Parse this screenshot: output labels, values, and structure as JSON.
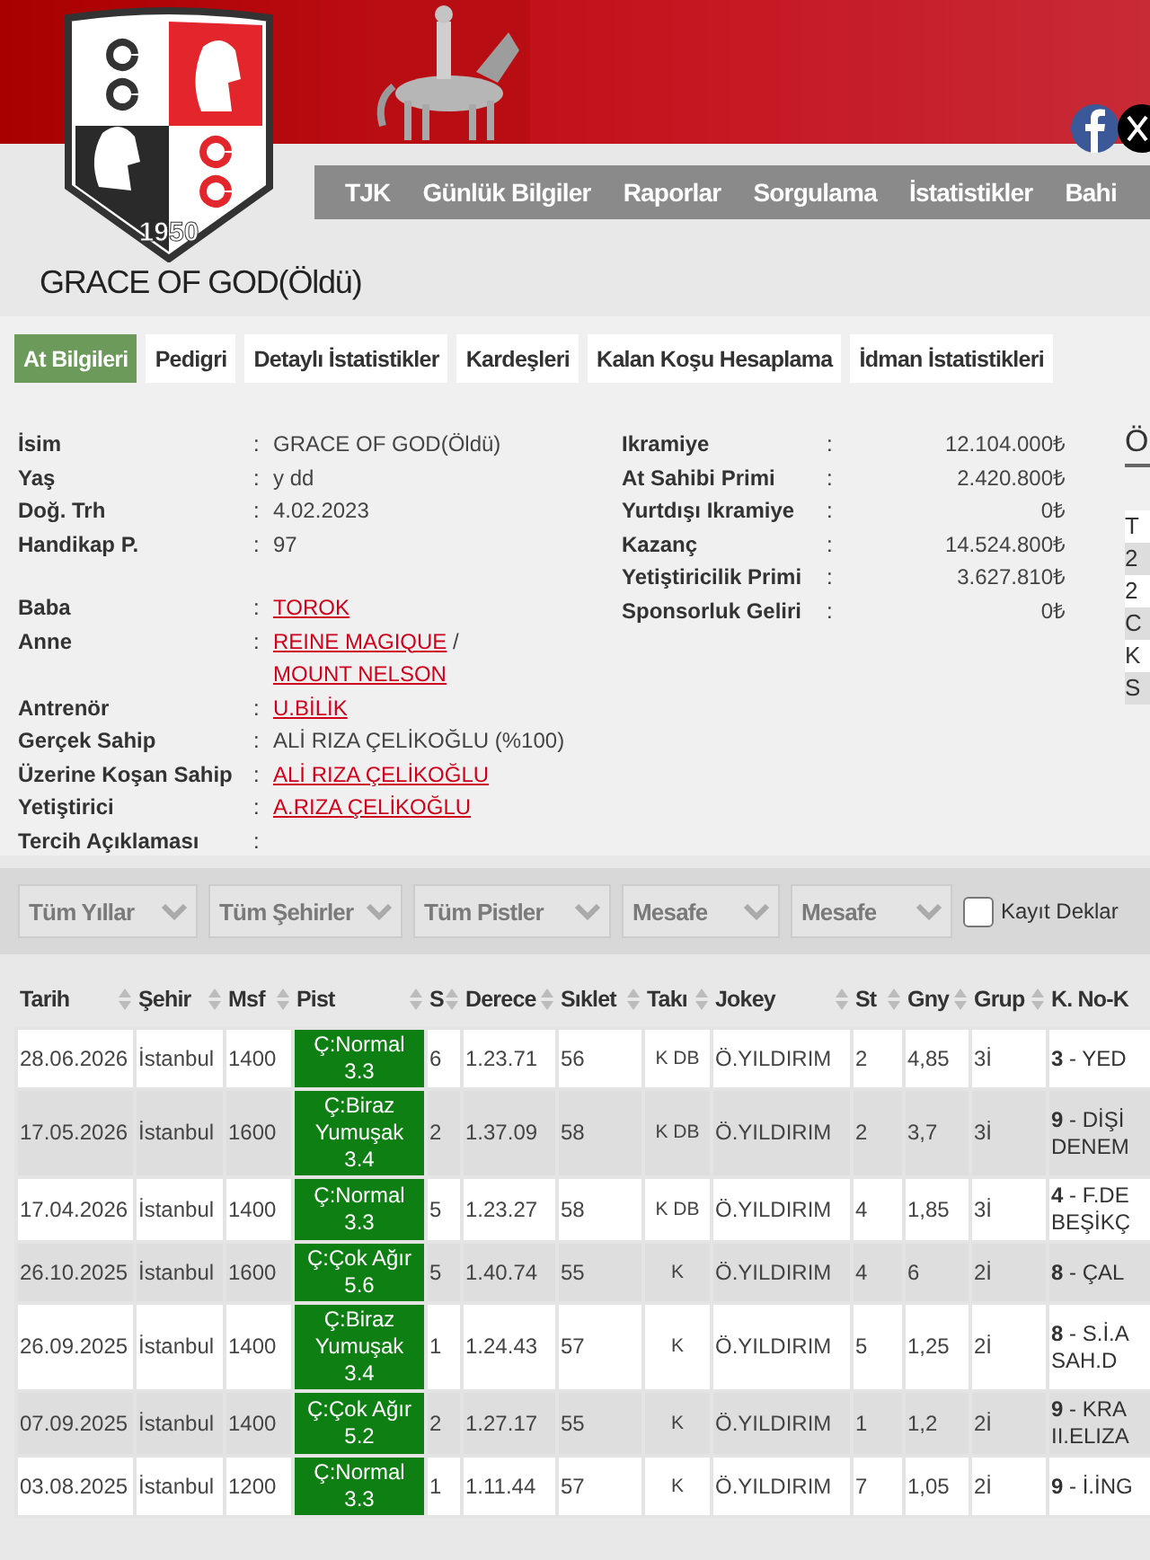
{
  "header": {
    "logo_year": "1950",
    "nav": [
      "TJK",
      "Günlük Bilgiler",
      "Raporlar",
      "Sorgulama",
      "İstatistikler",
      "Bahi"
    ]
  },
  "horse_name": "GRACE OF GOD(Öldü)",
  "tabs": [
    {
      "label": "At Bilgileri",
      "selected": true
    },
    {
      "label": "Pedigri",
      "selected": false
    },
    {
      "label": "Detaylı İstatistikler",
      "selected": false
    },
    {
      "label": "Kardeşleri",
      "selected": false
    },
    {
      "label": "Kalan Koşu Hesaplama",
      "selected": false
    },
    {
      "label": "İdman İstatistikleri",
      "selected": false
    }
  ],
  "info_left": [
    [
      {
        "label": "İsim",
        "parts": [
          {
            "text": "GRACE OF GOD(Öldü)",
            "link": false
          }
        ]
      },
      {
        "label": "Yaş",
        "parts": [
          {
            "text": "y dd",
            "link": false
          }
        ]
      },
      {
        "label": "Doğ. Trh",
        "parts": [
          {
            "text": "4.02.2023",
            "link": false
          }
        ]
      },
      {
        "label": "Handikap P.",
        "parts": [
          {
            "text": "97",
            "link": false
          }
        ]
      }
    ],
    [
      {
        "label": "Baba",
        "parts": [
          {
            "text": "TOROK",
            "link": true
          }
        ]
      },
      {
        "label": "Anne",
        "parts": [
          {
            "text": "REINE MAGIQUE",
            "link": true
          },
          {
            "text": "/",
            "link": false
          },
          {
            "text": "MOUNT NELSON",
            "link": true
          }
        ]
      },
      {
        "label": "Antrenör",
        "parts": [
          {
            "text": "U.BİLİK",
            "link": true
          }
        ]
      },
      {
        "label": "Gerçek Sahip",
        "parts": [
          {
            "text": "ALİ RIZA ÇELİKOĞLU (%100)",
            "link": false
          }
        ]
      },
      {
        "label": "Üzerine Koşan Sahip",
        "parts": [
          {
            "text": "ALİ RIZA ÇELİKOĞLU",
            "link": true
          }
        ]
      },
      {
        "label": "Yetiştirici",
        "parts": [
          {
            "text": "A.RIZA ÇELİKOĞLU",
            "link": true
          }
        ]
      },
      {
        "label": "Tercih Açıklaması"
      }
    ]
  ],
  "separator": ":",
  "info_right": [
    {
      "label": "Ikramiye",
      "value": "12.104.000₺"
    },
    {
      "label": "At Sahibi Primi",
      "value": "2.420.800₺"
    },
    {
      "label": "Yurtdışı Ikramiye",
      "value": "0₺"
    },
    {
      "label": "Kazanç",
      "value": "14.524.800₺"
    },
    {
      "label": "Yetiştiricilik Primi",
      "value": "3.627.810₺"
    },
    {
      "label": "Sponsorluk Geliri",
      "value": "0₺"
    }
  ],
  "side_panel": {
    "heading": "Ö",
    "rows": [
      "T",
      "2",
      "2",
      "C",
      "K",
      "S"
    ]
  },
  "filters": {
    "selects": [
      "Tüm Yıllar",
      "Tüm Şehirler",
      "Tüm Pistler",
      "Mesafe",
      "Mesafe"
    ],
    "checkbox": {
      "label": "Kayıt Deklar",
      "checked": false
    }
  },
  "table": {
    "columns": [
      "Tarih",
      "Şehir",
      "Msf",
      "Pist",
      "S",
      "Derece",
      "Sıklet",
      "Takı",
      "Jokey",
      "St",
      "Gny",
      "Grup",
      "K. No-K"
    ],
    "rows": [
      {
        "cells": [
          "28.06.2026",
          "İstanbul",
          "1400",
          {
            "surface": "Ç:Normal",
            "rating": "3.3"
          },
          "6",
          "1.23.71",
          "56",
          "K DB",
          "Ö.YILDIRIM",
          "2",
          "4,85",
          "3İ",
          "**3** - YED"
        ]
      },
      {
        "cells": [
          "17.05.2026",
          "İstanbul",
          "1600",
          {
            "surface": "Ç:Biraz Yumuşak",
            "rating": "3.4"
          },
          "2",
          "1.37.09",
          "58",
          "K DB",
          "Ö.YILDIRIM",
          "2",
          "3,7",
          "3İ",
          "**9** - DİŞİ DENEM"
        ]
      },
      {
        "cells": [
          "17.04.2026",
          "İstanbul",
          "1400",
          {
            "surface": "Ç:Normal",
            "rating": "3.3"
          },
          "5",
          "1.23.27",
          "58",
          "K DB",
          "Ö.YILDIRIM",
          "4",
          "1,85",
          "3İ",
          "**4** - F.DE BEŞİKÇ"
        ]
      },
      {
        "cells": [
          "26.10.2025",
          "İstanbul",
          "1600",
          {
            "surface": "Ç:Çok Ağır",
            "rating": "5.6"
          },
          "5",
          "1.40.74",
          "55",
          "K",
          "Ö.YILDIRIM",
          "4",
          "6",
          "2İ",
          "**8** - ÇAL"
        ]
      },
      {
        "cells": [
          "26.09.2025",
          "İstanbul",
          "1400",
          {
            "surface": "Ç:Biraz Yumuşak",
            "rating": "3.4"
          },
          "1",
          "1.24.43",
          "57",
          "K",
          "Ö.YILDIRIM",
          "5",
          "1,25",
          "2İ",
          "**8** - S.İ.A SAH.D"
        ]
      },
      {
        "cells": [
          "07.09.2025",
          "İstanbul",
          "1400",
          {
            "surface": "Ç:Çok Ağır",
            "rating": "5.2"
          },
          "2",
          "1.27.17",
          "55",
          "K",
          "Ö.YILDIRIM",
          "1",
          "1,2",
          "2İ",
          "**9** - KRA II.ELIZA"
        ]
      },
      {
        "cells": [
          "03.08.2025",
          "İstanbul",
          "1200",
          {
            "surface": "Ç:Normal",
            "rating": "3.3"
          },
          "1",
          "1.11.44",
          "57",
          "K",
          "Ö.YILDIRIM",
          "7",
          "1,05",
          "2İ",
          "**9** - İ.İNG"
        ]
      }
    ]
  }
}
